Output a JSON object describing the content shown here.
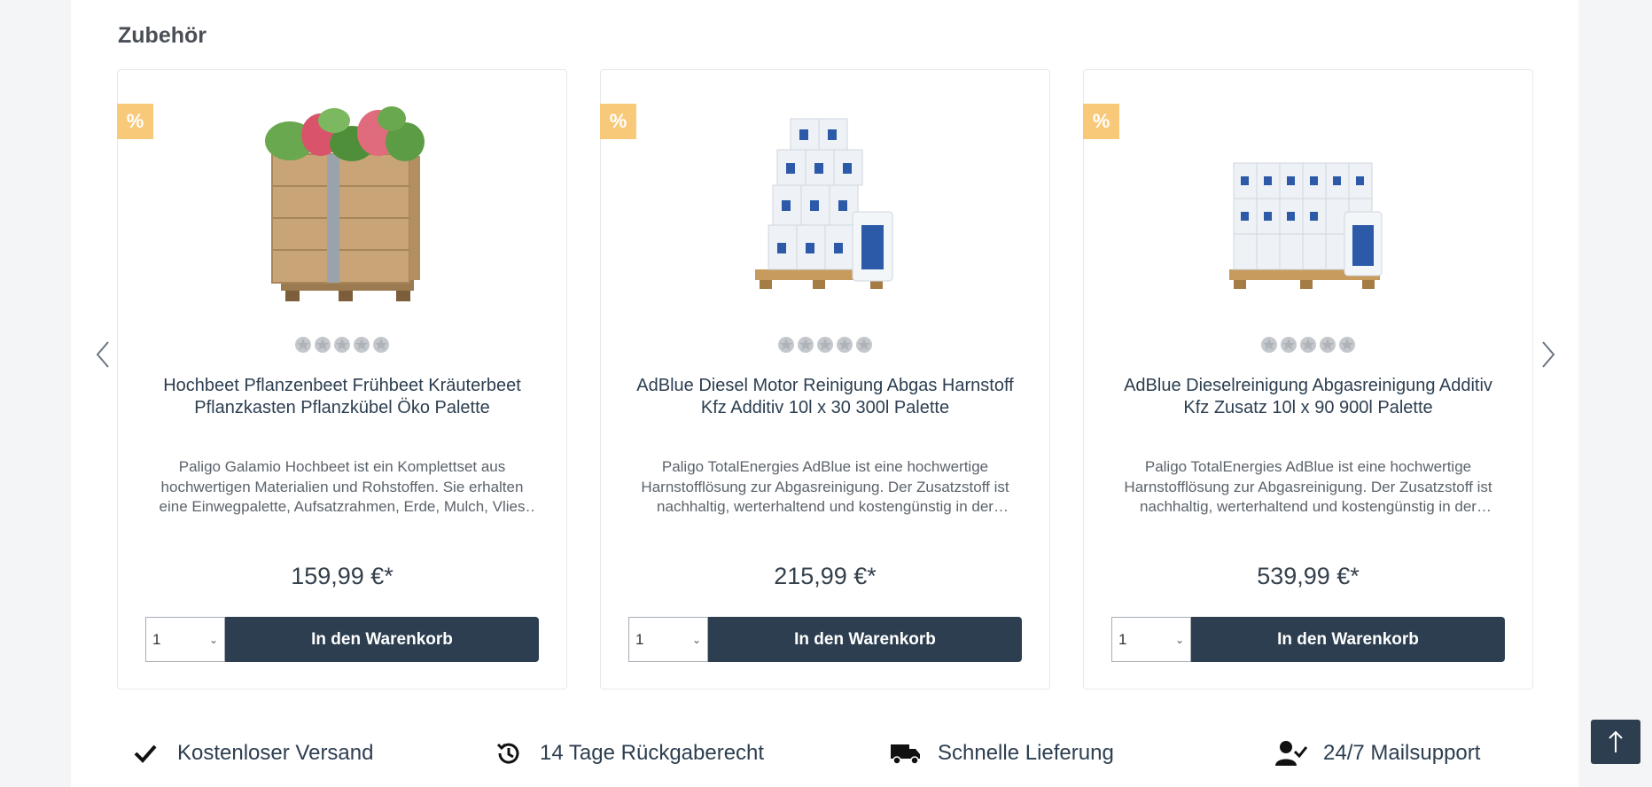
{
  "section": {
    "title": "Zubehör"
  },
  "products": [
    {
      "badge": "%",
      "name": "Hochbeet Pflanzenbeet Frühbeet Kräuterbeet Pflanzkasten Pflanzkübel Öko Palette",
      "description": "Paligo Galamio Hochbeet ist ein Komplettset aus hochwertigen Materialien und Rohstoffen. Sie erhalten eine Einwegpalette, Aufsatzrahmen, Erde, Mulch, Vlies und Pflanzen.",
      "price": "159,99 €*",
      "quantity": "1",
      "button_label": "In den Warenkorb",
      "rating_stars": 5,
      "image": "raised-garden-bed-image"
    },
    {
      "badge": "%",
      "name": "AdBlue Diesel Motor Reinigung Abgas Harnstoff Kfz Additiv 10l x 30 300l Palette",
      "description": "Paligo TotalEnergies AdBlue ist eine hochwertige Harnstofflösung zur Abgasreinigung. Der Zusatzstoff ist nachhaltig, werterhaltend und kostengünstig in der Anwendung.",
      "price": "215,99 €*",
      "quantity": "1",
      "button_label": "In den Warenkorb",
      "rating_stars": 5,
      "image": "adblue-pallet-small-image"
    },
    {
      "badge": "%",
      "name": "AdBlue Dieselreinigung Abgasreinigung Additiv Kfz Zusatz 10l x 90 900l Palette",
      "description": "Paligo TotalEnergies AdBlue ist eine hochwertige Harnstofflösung zur Abgasreinigung. Der Zusatzstoff ist nachhaltig, werterhaltend und kostengünstig in der Anwendung.",
      "price": "539,99 €*",
      "quantity": "1",
      "button_label": "In den Warenkorb",
      "rating_stars": 5,
      "image": "adblue-pallet-large-image"
    }
  ],
  "features": [
    {
      "label": "Kostenloser Versand",
      "icon": "checkmark-icon"
    },
    {
      "label": "14 Tage Rückgaberecht",
      "icon": "history-icon"
    },
    {
      "label": "Schnelle Lieferung",
      "icon": "truck-icon"
    },
    {
      "label": "24/7 Mailsupport",
      "icon": "user-check-icon"
    }
  ],
  "colors": {
    "primary": "#2c3e50",
    "badge": "#f9c97a",
    "star_empty": "#c4c8cc"
  }
}
